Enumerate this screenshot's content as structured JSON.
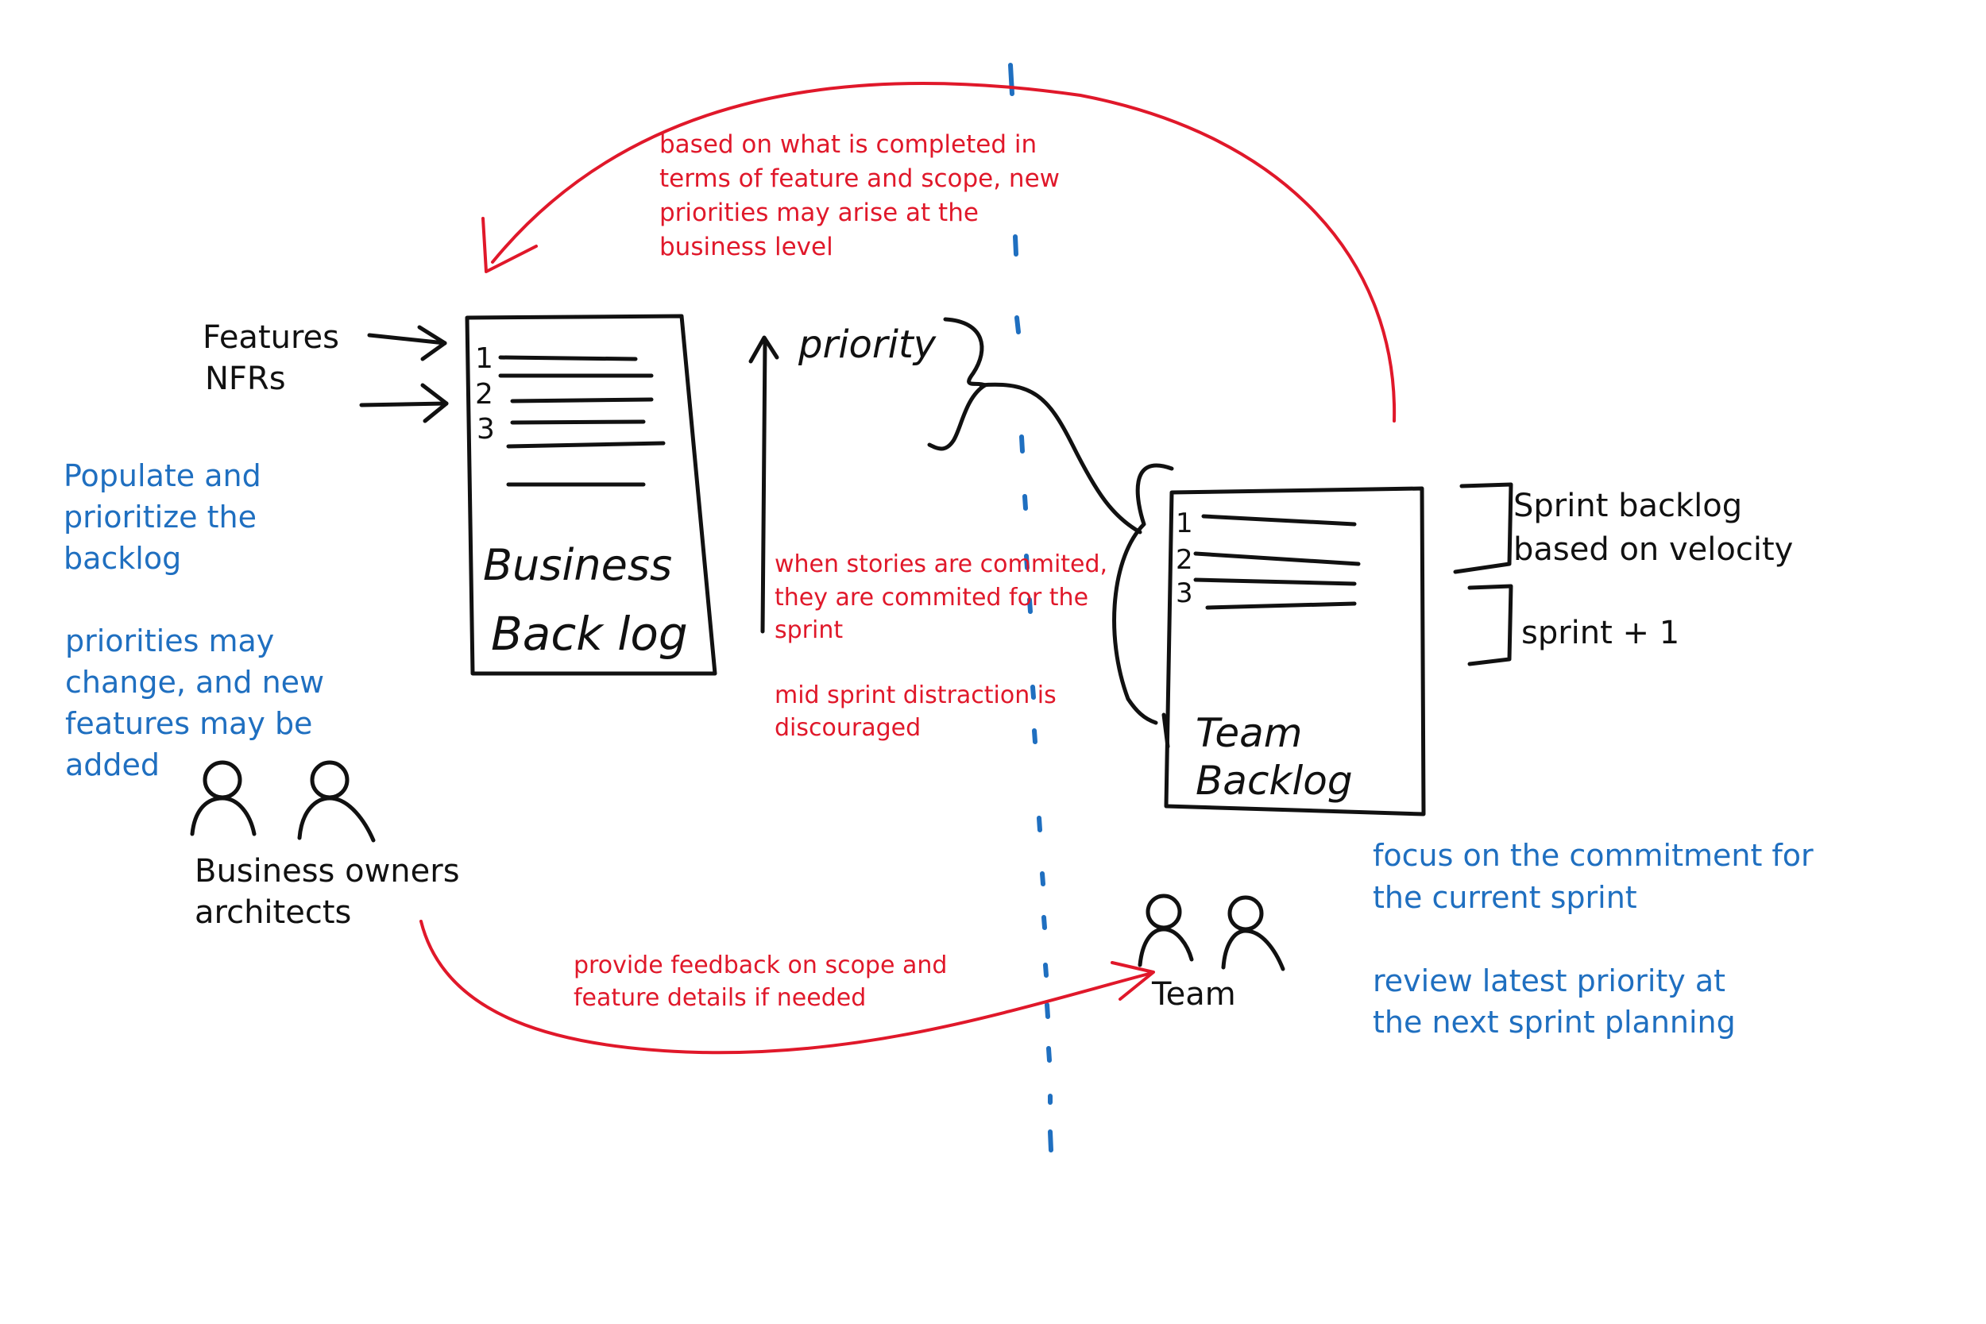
{
  "business_backlog": {
    "label_line1": "Business",
    "label_line2": "Back log",
    "numbers": [
      "1",
      "2",
      "3"
    ]
  },
  "team_backlog": {
    "label_line1": "Team",
    "label_line2": "Backlog",
    "numbers": [
      "1",
      "2",
      "3"
    ]
  },
  "inputs": {
    "features": "Features",
    "nfrs": "NFRs"
  },
  "priority_label": "priority",
  "sprint_labels": {
    "sprint_backlog_line1": "Sprint backlog",
    "sprint_backlog_line2": "based on velocity",
    "sprint_plus_one": "sprint + 1"
  },
  "business_owners": {
    "line1": "Business owners",
    "line2": "architects"
  },
  "team_label": "Team",
  "notes_blue_left": {
    "populate": [
      "Populate and",
      "prioritize the",
      "backlog"
    ],
    "priorities": [
      "priorities may",
      "change, and new",
      "features may be",
      "added"
    ]
  },
  "notes_blue_right": {
    "focus": [
      "focus on the commitment for",
      "the current sprint"
    ],
    "review": [
      "review latest priority at",
      "the next sprint planning"
    ]
  },
  "notes_red": {
    "top": [
      "based on what is completed in",
      "terms of feature and scope, new",
      "priorities may arise at the",
      "business level"
    ],
    "commit": [
      "when stories are commited,",
      "they are commited for the",
      "sprint"
    ],
    "distraction": [
      "mid sprint distraction is",
      "discouraged"
    ],
    "feedback": [
      "provide feedback on scope and",
      "feature details if needed"
    ]
  },
  "colors": {
    "ink": "#111111",
    "blue": "#1f6fc0",
    "red": "#e0182a",
    "background": "#ffffff"
  }
}
